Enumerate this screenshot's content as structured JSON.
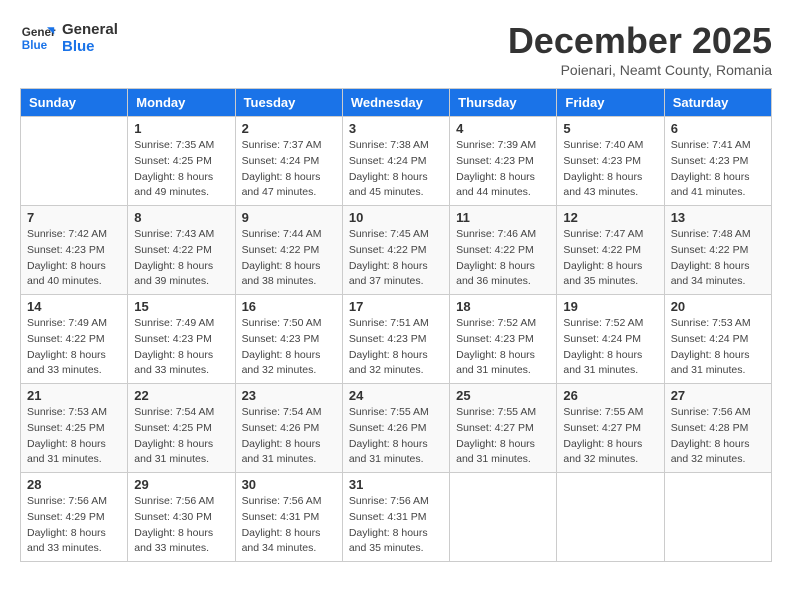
{
  "logo": {
    "line1": "General",
    "line2": "Blue"
  },
  "title": "December 2025",
  "subtitle": "Poienari, Neamt County, Romania",
  "days_header": [
    "Sunday",
    "Monday",
    "Tuesday",
    "Wednesday",
    "Thursday",
    "Friday",
    "Saturday"
  ],
  "weeks": [
    [
      {
        "num": "",
        "info": ""
      },
      {
        "num": "1",
        "info": "Sunrise: 7:35 AM\nSunset: 4:25 PM\nDaylight: 8 hours\nand 49 minutes."
      },
      {
        "num": "2",
        "info": "Sunrise: 7:37 AM\nSunset: 4:24 PM\nDaylight: 8 hours\nand 47 minutes."
      },
      {
        "num": "3",
        "info": "Sunrise: 7:38 AM\nSunset: 4:24 PM\nDaylight: 8 hours\nand 45 minutes."
      },
      {
        "num": "4",
        "info": "Sunrise: 7:39 AM\nSunset: 4:23 PM\nDaylight: 8 hours\nand 44 minutes."
      },
      {
        "num": "5",
        "info": "Sunrise: 7:40 AM\nSunset: 4:23 PM\nDaylight: 8 hours\nand 43 minutes."
      },
      {
        "num": "6",
        "info": "Sunrise: 7:41 AM\nSunset: 4:23 PM\nDaylight: 8 hours\nand 41 minutes."
      }
    ],
    [
      {
        "num": "7",
        "info": "Sunrise: 7:42 AM\nSunset: 4:23 PM\nDaylight: 8 hours\nand 40 minutes."
      },
      {
        "num": "8",
        "info": "Sunrise: 7:43 AM\nSunset: 4:22 PM\nDaylight: 8 hours\nand 39 minutes."
      },
      {
        "num": "9",
        "info": "Sunrise: 7:44 AM\nSunset: 4:22 PM\nDaylight: 8 hours\nand 38 minutes."
      },
      {
        "num": "10",
        "info": "Sunrise: 7:45 AM\nSunset: 4:22 PM\nDaylight: 8 hours\nand 37 minutes."
      },
      {
        "num": "11",
        "info": "Sunrise: 7:46 AM\nSunset: 4:22 PM\nDaylight: 8 hours\nand 36 minutes."
      },
      {
        "num": "12",
        "info": "Sunrise: 7:47 AM\nSunset: 4:22 PM\nDaylight: 8 hours\nand 35 minutes."
      },
      {
        "num": "13",
        "info": "Sunrise: 7:48 AM\nSunset: 4:22 PM\nDaylight: 8 hours\nand 34 minutes."
      }
    ],
    [
      {
        "num": "14",
        "info": "Sunrise: 7:49 AM\nSunset: 4:22 PM\nDaylight: 8 hours\nand 33 minutes."
      },
      {
        "num": "15",
        "info": "Sunrise: 7:49 AM\nSunset: 4:23 PM\nDaylight: 8 hours\nand 33 minutes."
      },
      {
        "num": "16",
        "info": "Sunrise: 7:50 AM\nSunset: 4:23 PM\nDaylight: 8 hours\nand 32 minutes."
      },
      {
        "num": "17",
        "info": "Sunrise: 7:51 AM\nSunset: 4:23 PM\nDaylight: 8 hours\nand 32 minutes."
      },
      {
        "num": "18",
        "info": "Sunrise: 7:52 AM\nSunset: 4:23 PM\nDaylight: 8 hours\nand 31 minutes."
      },
      {
        "num": "19",
        "info": "Sunrise: 7:52 AM\nSunset: 4:24 PM\nDaylight: 8 hours\nand 31 minutes."
      },
      {
        "num": "20",
        "info": "Sunrise: 7:53 AM\nSunset: 4:24 PM\nDaylight: 8 hours\nand 31 minutes."
      }
    ],
    [
      {
        "num": "21",
        "info": "Sunrise: 7:53 AM\nSunset: 4:25 PM\nDaylight: 8 hours\nand 31 minutes."
      },
      {
        "num": "22",
        "info": "Sunrise: 7:54 AM\nSunset: 4:25 PM\nDaylight: 8 hours\nand 31 minutes."
      },
      {
        "num": "23",
        "info": "Sunrise: 7:54 AM\nSunset: 4:26 PM\nDaylight: 8 hours\nand 31 minutes."
      },
      {
        "num": "24",
        "info": "Sunrise: 7:55 AM\nSunset: 4:26 PM\nDaylight: 8 hours\nand 31 minutes."
      },
      {
        "num": "25",
        "info": "Sunrise: 7:55 AM\nSunset: 4:27 PM\nDaylight: 8 hours\nand 31 minutes."
      },
      {
        "num": "26",
        "info": "Sunrise: 7:55 AM\nSunset: 4:27 PM\nDaylight: 8 hours\nand 32 minutes."
      },
      {
        "num": "27",
        "info": "Sunrise: 7:56 AM\nSunset: 4:28 PM\nDaylight: 8 hours\nand 32 minutes."
      }
    ],
    [
      {
        "num": "28",
        "info": "Sunrise: 7:56 AM\nSunset: 4:29 PM\nDaylight: 8 hours\nand 33 minutes."
      },
      {
        "num": "29",
        "info": "Sunrise: 7:56 AM\nSunset: 4:30 PM\nDaylight: 8 hours\nand 33 minutes."
      },
      {
        "num": "30",
        "info": "Sunrise: 7:56 AM\nSunset: 4:31 PM\nDaylight: 8 hours\nand 34 minutes."
      },
      {
        "num": "31",
        "info": "Sunrise: 7:56 AM\nSunset: 4:31 PM\nDaylight: 8 hours\nand 35 minutes."
      },
      {
        "num": "",
        "info": ""
      },
      {
        "num": "",
        "info": ""
      },
      {
        "num": "",
        "info": ""
      }
    ]
  ]
}
